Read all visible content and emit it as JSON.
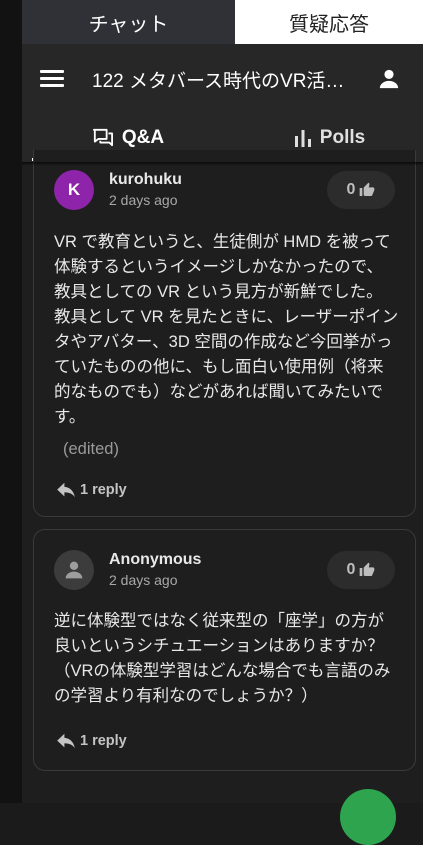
{
  "top_tabs": {
    "chat": "チャット",
    "qa": "質疑応答"
  },
  "header": {
    "title": "122 メタバース時代のVR活…"
  },
  "subtabs": {
    "qa": "Q&A",
    "polls": "Polls"
  },
  "posts": [
    {
      "avatar_letter": "K",
      "author": "kurohuku",
      "time": "2 days ago",
      "likes": "0",
      "body": "VR で教育というと、生徒側が HMD を被って体験するというイメージしかなかったので、教具としての VR という見方が新鮮でした。教具として VR を見たときに、レーザーポインタやアバター、3D 空間の作成など今回挙がっていたものの他に、もし面白い使用例（将来的なものでも）などがあれば聞いてみたいです。",
      "edited": "(edited)",
      "reply": "1 reply"
    },
    {
      "author": "Anonymous",
      "time": "2 days ago",
      "likes": "0",
      "body": "逆に体験型ではなく従来型の「座学」の方が良いというシチュエーションはありますか？（VRの体験型学習はどんな場合でも言語のみの学習より有利なのでしょうか？）",
      "reply": "1 reply"
    }
  ]
}
